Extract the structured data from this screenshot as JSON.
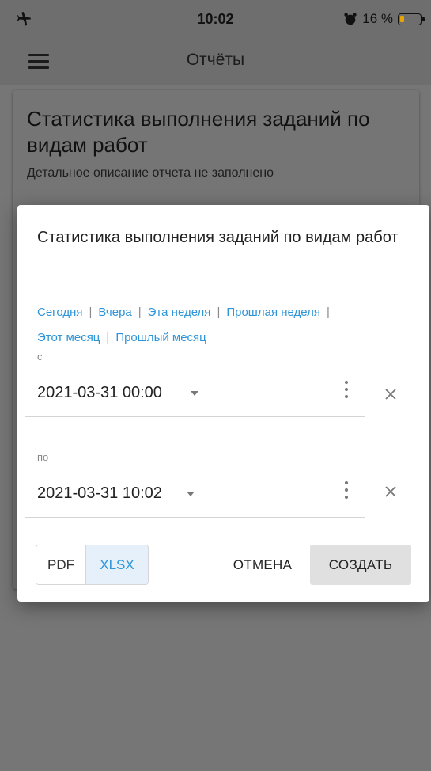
{
  "status_bar": {
    "time": "10:02",
    "battery_text": "16 %"
  },
  "app_bar": {
    "title": "Отчёты",
    "menu_icon": "menu-icon"
  },
  "report_card": {
    "title": "Статистика выполнения заданий по видам работ",
    "description": "Детальное описание отчета не заполнено"
  },
  "dialog": {
    "title": "Статистика выполнения заданий по видам работ",
    "quick_ranges": [
      "Сегодня",
      "Вчера",
      "Эта неделя",
      "Прошлая неделя",
      "Этот месяц",
      "Прошлый месяц"
    ],
    "from": {
      "label": "с",
      "value": "2021-03-31 00:00"
    },
    "to": {
      "label": "по",
      "value": "2021-03-31 10:02"
    },
    "formats": {
      "pdf": "PDF",
      "xlsx": "XLSX",
      "selected": "XLSX"
    },
    "cancel_label": "ОТМЕНА",
    "create_label": "СОЗДАТЬ"
  },
  "colors": {
    "link": "#2e95d8",
    "overlay": "#767676",
    "selected_bg": "#e5f0fb"
  }
}
